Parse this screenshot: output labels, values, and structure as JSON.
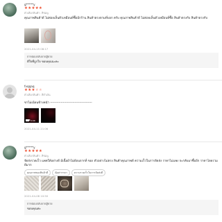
{
  "reviews": [
    {
      "username": "g*****y",
      "stars_filled": 5,
      "stars_total": 5,
      "variation": "ตัวเลือกสินค้า: สีชมพู",
      "text": "คุณภาพสินค้าดี ไม่ค่อยเห็นตัวเหมือนที่ซื้อมีกร้าน สินค้าตรงตามที่บอก ครับ คุณภาพสินค้าดี ไม่ค่อยเห็นตัวเหมือนที่ซื้อ สินค้าตรงกับ สินค้าตรงกับ",
      "timestamp": "2021-04-15 08:17",
      "seller_title": "การตอบกลับจากผู้ขาย",
      "seller_text": "ดีใจที่ถูกใจ ขอบคุณนะคะ",
      "star_color": "#ee4d2d"
    },
    {
      "username": "fvqqaq",
      "stars_filled": 3,
      "stars_total": 5,
      "variation": "ตัวเลือกสินค้า: สีดำเงิน",
      "text": "ขาไม่เนียนข้างหนัา ---------------------------------------",
      "timestamp": "2021-04-11 21:06",
      "video_duration": "0:06",
      "star_color": "#ee4d2d"
    },
    {
      "username": "g*****y",
      "stars_filled": 5,
      "stars_total": 5,
      "variation": "ตัวเลือกสินค้า: สีชมพู",
      "text": "จัดส่งรวดเร็ว แพคให้อย่างดี มีเนื้อผ้าไม่ย้อนจากที่ ของ ตัวอย่างไม่ตรง สินค้าคุณภาพดี ความเร็วในการจัดส่ง ราคาไม่แพง จะกลับมาซื้ออีก ราคาโดยรวมดีมาก",
      "tags": [
        "คุณภาพของสินค้าดี",
        "คุ้มค่าราคา",
        "ความรวดเร็วในการจัดส่งดี"
      ],
      "timestamp": "2021-04-08 10:50",
      "seller_title": "การตอบกลับจากผู้ขาย",
      "seller_text": "ขอบคุณค่ะ",
      "star_color": "#ee4d2d"
    }
  ]
}
